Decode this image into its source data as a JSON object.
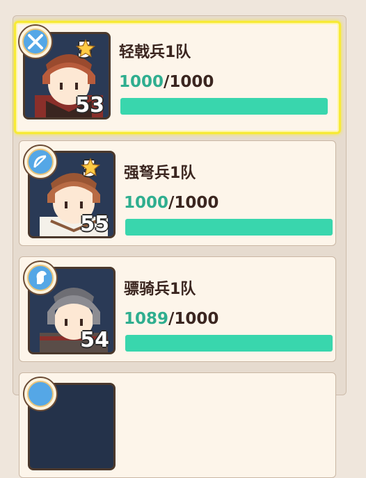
{
  "units": [
    {
      "name": "轻戟兵1队",
      "stars": "5",
      "level": "53",
      "current": "1000",
      "separator": "/",
      "max": "1000",
      "fill_fraction": 1.0,
      "type_icon": "crossed-swords-icon",
      "selected": true
    },
    {
      "name": "强弩兵1队",
      "stars": "5",
      "level": "55",
      "current": "1000",
      "separator": "/",
      "max": "1000",
      "fill_fraction": 1.0,
      "type_icon": "bow-icon",
      "selected": false
    },
    {
      "name": "骠骑兵1队",
      "stars": "",
      "level": "54",
      "current": "1089",
      "separator": "/",
      "max": "1000",
      "fill_fraction": 1.0,
      "type_icon": "horse-head-icon",
      "selected": false
    }
  ],
  "colors": {
    "accent_green": "#39d6ad",
    "current_text": "#2fae8f",
    "selected_border": "#f7ea35",
    "card_bg": "#fdf5ea"
  }
}
